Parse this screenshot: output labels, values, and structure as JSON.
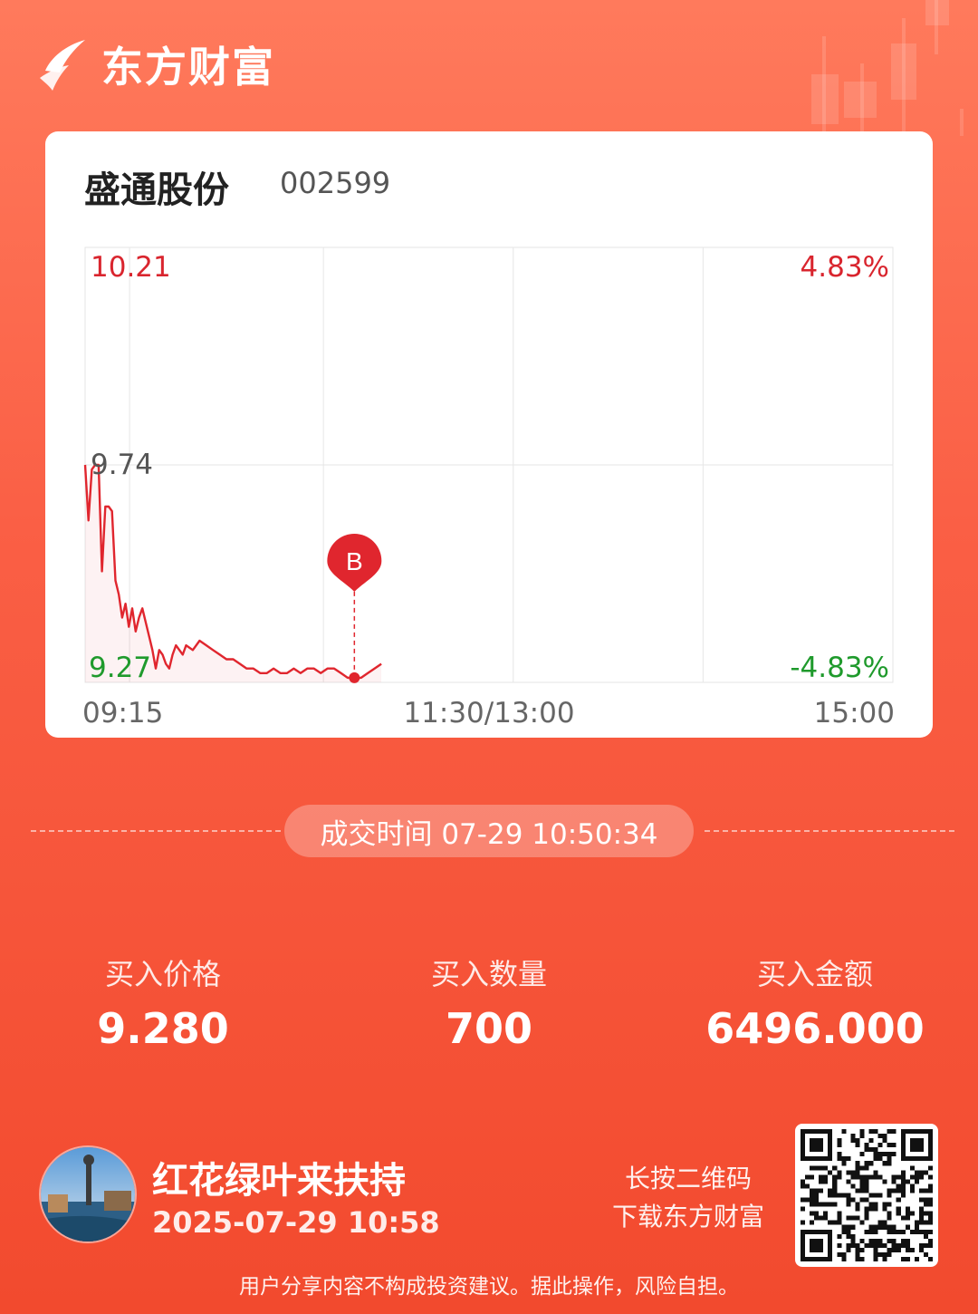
{
  "app": {
    "brand": "东方财富",
    "logo_icon": "eastmoney-logo-icon"
  },
  "stock": {
    "name": "盛通股份",
    "code": "002599"
  },
  "chart_data": {
    "type": "line",
    "price_levels": [
      "10.21",
      "9.74",
      "9.27"
    ],
    "pct_levels": [
      "4.83%",
      "-4.83%"
    ],
    "x_labels": [
      "09:15",
      "11:30/13:00",
      "15:00"
    ],
    "ylim": [
      9.27,
      10.21
    ],
    "prev_close": 9.74,
    "grid": true,
    "colors": {
      "line": "#e0262e",
      "up": "#d9252e",
      "down": "#1f9a2c",
      "neutral": "#555555"
    },
    "buy_marker": {
      "label": "B",
      "time": "10:50",
      "price": 9.28
    },
    "series": [
      {
        "x": [
          "09:30",
          "09:31",
          "09:32",
          "09:33",
          "09:34",
          "09:35",
          "09:36",
          "09:37",
          "09:38",
          "09:39",
          "09:40",
          "09:41",
          "09:42",
          "09:43",
          "09:44",
          "09:45",
          "09:46",
          "09:47",
          "09:48",
          "09:49",
          "09:50",
          "09:51",
          "09:52",
          "09:53",
          "09:54",
          "09:55",
          "09:56",
          "09:57",
          "09:58",
          "09:59",
          "10:00",
          "10:02",
          "10:04",
          "10:06",
          "10:08",
          "10:10",
          "10:12",
          "10:14",
          "10:16",
          "10:18",
          "10:20",
          "10:22",
          "10:24",
          "10:26",
          "10:28",
          "10:30",
          "10:32",
          "10:34",
          "10:36",
          "10:38",
          "10:40",
          "10:42",
          "10:44",
          "10:46",
          "10:48",
          "10:50",
          "10:52",
          "10:54",
          "10:56",
          "10:58"
        ],
        "values": [
          9.74,
          9.62,
          9.73,
          9.74,
          9.74,
          9.51,
          9.65,
          9.65,
          9.64,
          9.49,
          9.46,
          9.41,
          9.44,
          9.39,
          9.43,
          9.38,
          9.41,
          9.43,
          9.4,
          9.37,
          9.34,
          9.3,
          9.34,
          9.33,
          9.31,
          9.3,
          9.33,
          9.35,
          9.34,
          9.33,
          9.35,
          9.34,
          9.36,
          9.35,
          9.34,
          9.33,
          9.32,
          9.32,
          9.31,
          9.3,
          9.3,
          9.29,
          9.29,
          9.3,
          9.29,
          9.29,
          9.3,
          9.29,
          9.3,
          9.3,
          9.29,
          9.3,
          9.3,
          9.29,
          9.28,
          9.28,
          9.28,
          9.29,
          9.3,
          9.31
        ]
      }
    ]
  },
  "trade": {
    "time_label": "成交时间 07-29 10:50:34",
    "price_label": "买入价格",
    "price": "9.280",
    "qty_label": "买入数量",
    "qty": "700",
    "amount_label": "买入金额",
    "amount": "6496.000"
  },
  "user": {
    "name": "红花绿叶来扶持",
    "time": "2025-07-29 10:58",
    "avatar_icon": "avatar-icon"
  },
  "qr": {
    "hint_line1": "长按二维码",
    "hint_line2": "下载东方财富",
    "icon": "qr-code-icon"
  },
  "disclaimer": "用户分享内容不构成投资建议。据此操作，风险自担。"
}
